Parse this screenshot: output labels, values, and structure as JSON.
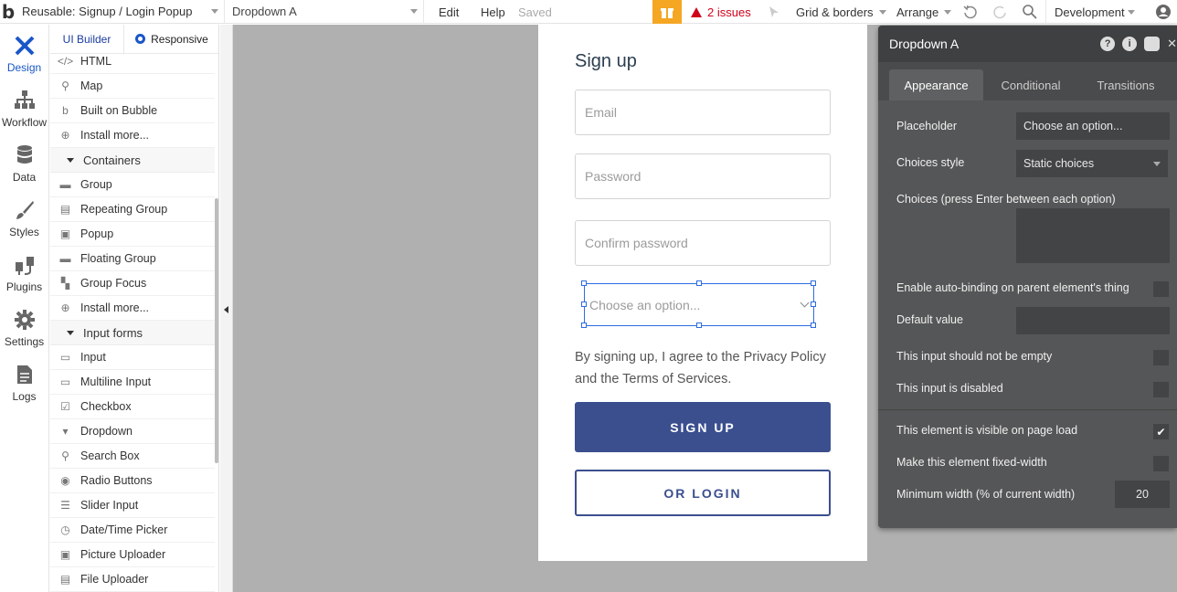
{
  "topbar": {
    "logo": "b",
    "page_name": "Reusable: Signup / Login Popup",
    "element_name": "Dropdown A",
    "edit": "Edit",
    "help": "Help",
    "saved": "Saved",
    "issues": "2 issues",
    "grid": "Grid & borders",
    "arrange": "Arrange",
    "env": "Development"
  },
  "rail": [
    {
      "label": "Design",
      "icon": "design-icon"
    },
    {
      "label": "Workflow",
      "icon": "workflow-icon"
    },
    {
      "label": "Data",
      "icon": "database-icon"
    },
    {
      "label": "Styles",
      "icon": "brush-icon"
    },
    {
      "label": "Plugins",
      "icon": "plug-icon"
    },
    {
      "label": "Settings",
      "icon": "gear-icon"
    },
    {
      "label": "Logs",
      "icon": "document-icon"
    }
  ],
  "panel": {
    "tab_builder": "UI Builder",
    "tab_responsive": "Responsive",
    "items": [
      {
        "label": "HTML",
        "kind": "item",
        "glyph": "</>"
      },
      {
        "label": "Map",
        "kind": "item",
        "glyph": "⚲"
      },
      {
        "label": "Built on Bubble",
        "kind": "item",
        "glyph": "b"
      },
      {
        "label": "Install more...",
        "kind": "item",
        "glyph": "⊕"
      },
      {
        "label": "Containers",
        "kind": "category"
      },
      {
        "label": "Group",
        "kind": "item",
        "glyph": "▬"
      },
      {
        "label": "Repeating Group",
        "kind": "item",
        "glyph": "▤"
      },
      {
        "label": "Popup",
        "kind": "item",
        "glyph": "▣"
      },
      {
        "label": "Floating Group",
        "kind": "item",
        "glyph": "▬"
      },
      {
        "label": "Group Focus",
        "kind": "item",
        "glyph": "▚"
      },
      {
        "label": "Install more...",
        "kind": "item",
        "glyph": "⊕"
      },
      {
        "label": "Input forms",
        "kind": "category"
      },
      {
        "label": "Input",
        "kind": "item",
        "glyph": "▭"
      },
      {
        "label": "Multiline Input",
        "kind": "item",
        "glyph": "▭"
      },
      {
        "label": "Checkbox",
        "kind": "item",
        "glyph": "☑"
      },
      {
        "label": "Dropdown",
        "kind": "item",
        "glyph": "▾"
      },
      {
        "label": "Search Box",
        "kind": "item",
        "glyph": "⚲"
      },
      {
        "label": "Radio Buttons",
        "kind": "item",
        "glyph": "◉"
      },
      {
        "label": "Slider Input",
        "kind": "item",
        "glyph": "☰"
      },
      {
        "label": "Date/Time Picker",
        "kind": "item",
        "glyph": "◷"
      },
      {
        "label": "Picture Uploader",
        "kind": "item",
        "glyph": "▣"
      },
      {
        "label": "File Uploader",
        "kind": "item",
        "glyph": "▤"
      }
    ]
  },
  "popup": {
    "title": "Sign up",
    "email_placeholder": "Email",
    "password_placeholder": "Password",
    "confirm_placeholder": "Confirm password",
    "dropdown_placeholder": "Choose an option...",
    "agree_text": "By signing up, I agree to the Privacy Policy and the Terms of Services.",
    "signup_label": "SIGN UP",
    "login_label": "OR LOGIN",
    "accent": "#3b4f8f"
  },
  "property_editor": {
    "title": "Dropdown A",
    "tabs": [
      "Appearance",
      "Conditional",
      "Transitions"
    ],
    "placeholder_label": "Placeholder",
    "placeholder_value": "Choose an option...",
    "choices_style_label": "Choices style",
    "choices_style_value": "Static choices",
    "choices_label": "Choices (press Enter between each option)",
    "autobind_label": "Enable auto-binding on parent element's thing",
    "default_label": "Default value",
    "not_empty_label": "This input should not be empty",
    "disabled_label": "This input is disabled",
    "visible_label": "This element is visible on page load",
    "fixed_width_label": "Make this element fixed-width",
    "min_width_label": "Minimum width (% of current width)",
    "min_width_value": "20"
  }
}
